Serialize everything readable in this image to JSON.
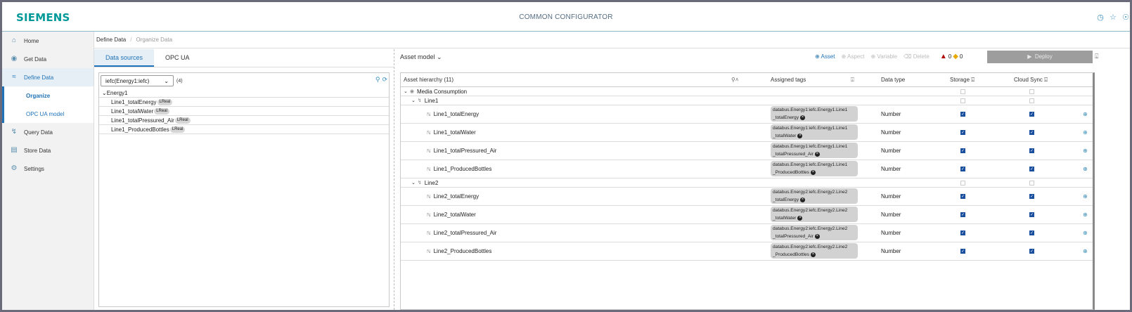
{
  "header": {
    "logo": "SIEMENS",
    "title": "COMMON CONFIGURATOR"
  },
  "sidebar": {
    "items": [
      {
        "label": "Home",
        "icon": "home-icon"
      },
      {
        "label": "Get Data",
        "icon": "get-data-icon"
      },
      {
        "label": "Define Data",
        "icon": "define-data-icon"
      },
      {
        "label": "Query Data",
        "icon": "query-data-icon"
      },
      {
        "label": "Store Data",
        "icon": "store-data-icon"
      },
      {
        "label": "Settings",
        "icon": "gear-icon"
      }
    ],
    "subitems": [
      {
        "label": "Organize"
      },
      {
        "label": "OPC UA model"
      }
    ]
  },
  "breadcrumb": {
    "item1": "Define Data",
    "item2": "Organize Data"
  },
  "left": {
    "tabs": [
      {
        "label": "Data sources"
      },
      {
        "label": "OPC UA"
      }
    ],
    "source_select": "iefc(Energy1:iefc)",
    "source_count": "(4)",
    "tree_root": "Energy1",
    "tree_items": [
      {
        "name": "Line1_totalEnergy",
        "type": "LReal"
      },
      {
        "name": "Line1_totalWater",
        "type": "LReal"
      },
      {
        "name": "Line1_totalPressured_Air",
        "type": "LReal"
      },
      {
        "name": "Line1_ProducedBottles",
        "type": "LReal"
      }
    ]
  },
  "right": {
    "title": "Asset model",
    "tools": {
      "asset": "Asset",
      "aspect": "Aspect",
      "variable": "Variable",
      "delete": "Delete"
    },
    "errors": "0",
    "warnings": "0",
    "deploy": "Deploy",
    "columns": {
      "hierarchy": "Asset hierarchy (11)",
      "tags": "Assigned tags",
      "type": "Data type",
      "storage": "Storage",
      "cloud": "Cloud Sync"
    },
    "root": "Media Consumption",
    "line1": "Line1",
    "line1_rows": [
      {
        "name": "Line1_totalEnergy",
        "tag1": "databus.Energy1:iefc.Energy1.Line1",
        "tag2": "_totalEnergy",
        "type": "Number"
      },
      {
        "name": "Line1_totalWater",
        "tag1": "databus.Energy1:iefc.Energy1.Line1",
        "tag2": "_totalWater",
        "type": "Number"
      },
      {
        "name": "Line1_totalPressured_Air",
        "tag1": "databus.Energy1:iefc.Energy1.Line1",
        "tag2": "_totalPressured_Air",
        "type": "Number"
      },
      {
        "name": "Line1_ProducedBottles",
        "tag1": "databus.Energy1:iefc.Energy1.Line1",
        "tag2": "_ProducedBottles",
        "type": "Number"
      }
    ],
    "line2": "Line2",
    "line2_rows": [
      {
        "name": "Line2_totalEnergy",
        "tag1": "databus.Energy2:iefc.Energy2.Line2",
        "tag2": "_totalEnergy",
        "type": "Number"
      },
      {
        "name": "Line2_totalWater",
        "tag1": "databus.Energy2:iefc.Energy2.Line2",
        "tag2": "_totalWater",
        "type": "Number"
      },
      {
        "name": "Line2_totalPressured_Air",
        "tag1": "databus.Energy2:iefc.Energy2.Line2",
        "tag2": "_totalPressured_Air",
        "type": "Number"
      },
      {
        "name": "Line2_ProducedBottles",
        "tag1": "databus.Energy2:iefc.Energy2.Line2",
        "tag2": "_ProducedBottles",
        "type": "Number"
      }
    ]
  }
}
